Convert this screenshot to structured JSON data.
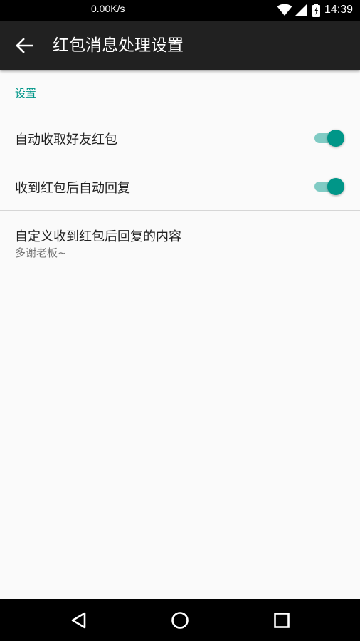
{
  "status_bar": {
    "network_speed": "0.00K/s",
    "time": "14:39",
    "icons": [
      "wifi-icon",
      "signal-icon",
      "battery-charging-icon"
    ]
  },
  "app_bar": {
    "title": "红包消息处理设置",
    "back_icon": "arrow-back-icon"
  },
  "settings": {
    "section_header": "设置",
    "items": [
      {
        "title": "自动收取好友红包",
        "type": "switch",
        "checked": true
      },
      {
        "title": "收到红包后自动回复",
        "type": "switch",
        "checked": true
      },
      {
        "title": "自定义收到红包后回复的内容",
        "summary": "多谢老板~",
        "type": "text"
      }
    ]
  },
  "nav_bar": {
    "icons": [
      "back-triangle-icon",
      "home-circle-icon",
      "recents-square-icon"
    ]
  },
  "colors": {
    "accent": "#009688",
    "track_on": "#80cbc4",
    "app_bar": "#212121",
    "background": "#fafafa"
  }
}
